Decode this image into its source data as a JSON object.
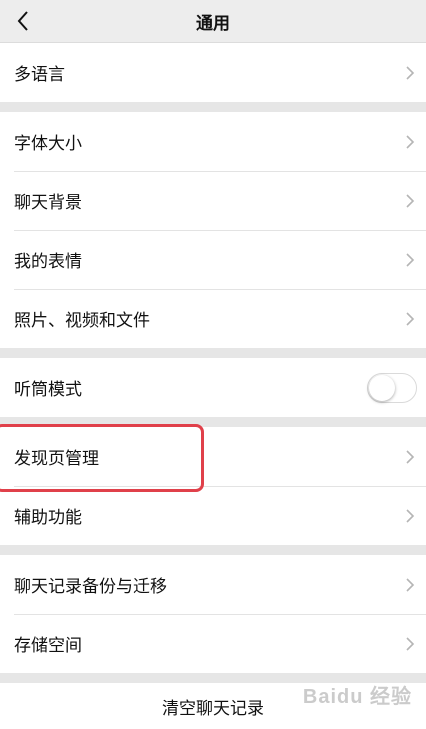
{
  "header": {
    "title": "通用",
    "back_icon": "chevron-left-icon"
  },
  "groups": [
    {
      "items": [
        {
          "label": "多语言"
        }
      ]
    },
    {
      "items": [
        {
          "label": "字体大小"
        },
        {
          "label": "聊天背景"
        },
        {
          "label": "我的表情"
        },
        {
          "label": "照片、视频和文件"
        }
      ]
    },
    {
      "items": [
        {
          "label": "听筒模式",
          "toggle": false
        }
      ]
    },
    {
      "items": [
        {
          "label": "发现页管理",
          "highlighted": true
        },
        {
          "label": "辅助功能"
        }
      ]
    },
    {
      "items": [
        {
          "label": "聊天记录备份与迁移"
        },
        {
          "label": "存储空间"
        }
      ]
    }
  ],
  "clear_chat": {
    "label": "清空聊天记录"
  },
  "watermark": {
    "text": "Baidu 经验"
  },
  "colors": {
    "highlight": "#e0404a",
    "background": "#efeff4"
  }
}
